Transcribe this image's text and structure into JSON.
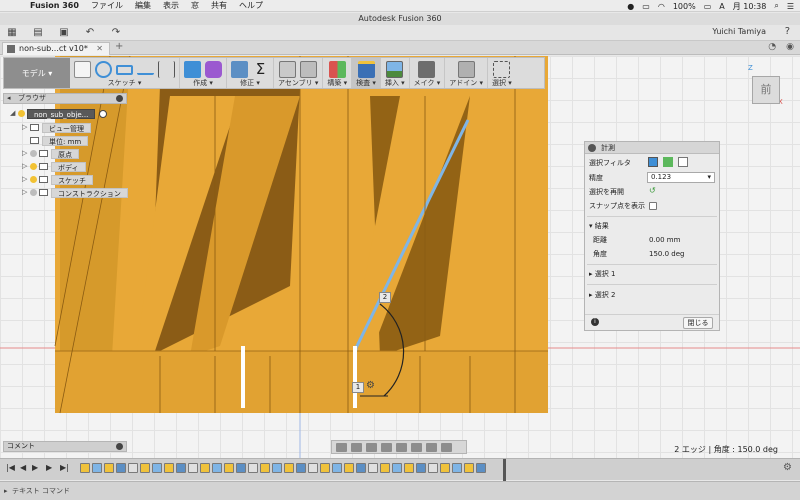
{
  "menubar": {
    "app_name": "Fusion 360",
    "items": [
      "ファイル",
      "編集",
      "表示",
      "窓",
      "共有",
      "ヘルプ"
    ],
    "battery": "100%",
    "input_method": "A",
    "clock": "月 10:38"
  },
  "window": {
    "title": "Autodesk Fusion 360"
  },
  "apptoolbar": {
    "user": "Yuichi Tamiya"
  },
  "tab": {
    "label": "non-sub...ct v10*"
  },
  "ribbon": {
    "workspace": "モデル",
    "groups": [
      {
        "label": "スケッチ ▾",
        "icons": [
          "sketch-icon",
          "spline-icon",
          "rectangle-icon",
          "line-icon",
          "dimension-icon"
        ]
      },
      {
        "label": "作成 ▾",
        "icons": [
          "box-icon",
          "form-icon"
        ]
      },
      {
        "label": "修正 ▾",
        "icons": [
          "press-pull-icon",
          "sum-icon"
        ]
      },
      {
        "label": "アセンブリ ▾",
        "icons": [
          "component-icon",
          "joint-icon"
        ]
      },
      {
        "label": "構築 ▾",
        "icons": [
          "plane-icon"
        ]
      },
      {
        "label": "検査 ▾",
        "icons": [
          "measure-icon"
        ]
      },
      {
        "label": "挿入 ▾",
        "icons": [
          "insert-image-icon"
        ]
      },
      {
        "label": "メイク ▾",
        "icons": [
          "make-icon"
        ]
      },
      {
        "label": "アドイン ▾",
        "icons": [
          "addins-icon"
        ]
      },
      {
        "label": "選択 ▾",
        "icons": [
          "select-icon"
        ]
      }
    ]
  },
  "browser": {
    "header": "ブラウザ",
    "root": "non_sub_obje...",
    "nodes": [
      "ビュー管理",
      "単位: mm",
      "原点",
      "ボディ",
      "スケッチ",
      "コンストラクション"
    ]
  },
  "viewcube": {
    "face": "前",
    "axis_x": "X",
    "axis_z": "Z"
  },
  "measure": {
    "title": "計測",
    "select_filter_label": "選択フィルタ",
    "precision_label": "精度",
    "precision_value": "0.123",
    "reselect_label": "選択を再開",
    "show_snap_label": "スナップ点を表示",
    "result_heading": "結果",
    "distance_label": "距離",
    "distance_value": "0.00 mm",
    "angle_label": "角度",
    "angle_value": "150.0 deg",
    "selection1": "選択 1",
    "selection2": "選択 2",
    "close_button": "閉じる"
  },
  "tags": {
    "one": "1",
    "two": "2"
  },
  "comment": {
    "label": "コメント"
  },
  "status": {
    "message": "2 エッジ | 角度 : 150.0 deg"
  },
  "textcommand": {
    "label": "テキスト コマンド"
  },
  "colors": {
    "wood": "#e8a837",
    "wood_dark": "#8a5b12",
    "wood_mid": "#c98d23",
    "accent_blue": "#3f8fd6",
    "selection_edge": "#7fb5e6"
  }
}
